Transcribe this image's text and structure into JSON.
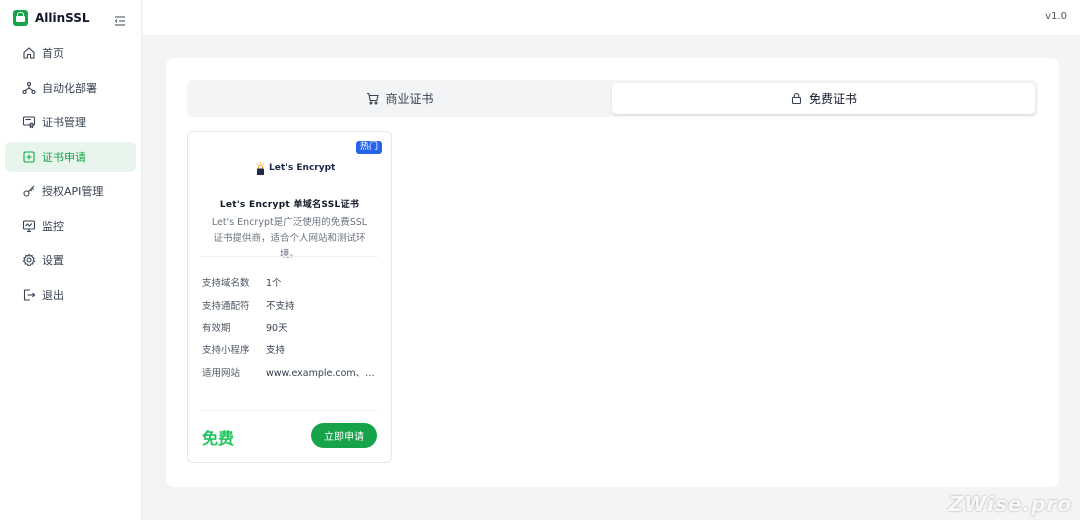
{
  "app": {
    "name": "AllinSSL",
    "version": "v1.0"
  },
  "sidebar": {
    "items": [
      {
        "label": "首页",
        "icon": "home-icon",
        "active": false
      },
      {
        "label": "自动化部署",
        "icon": "workflow-icon",
        "active": false
      },
      {
        "label": "证书管理",
        "icon": "certificate-icon",
        "active": false
      },
      {
        "label": "证书申请",
        "icon": "plus-square-icon",
        "active": true
      },
      {
        "label": "授权API管理",
        "icon": "key-icon",
        "active": false
      },
      {
        "label": "监控",
        "icon": "monitor-icon",
        "active": false
      },
      {
        "label": "设置",
        "icon": "gear-icon",
        "active": false
      },
      {
        "label": "退出",
        "icon": "logout-icon",
        "active": false
      }
    ]
  },
  "tabs": [
    {
      "label": "商业证书",
      "icon": "cart-icon",
      "selected": false
    },
    {
      "label": "免费证书",
      "icon": "lock-icon",
      "selected": true
    }
  ],
  "product": {
    "badge": "热门",
    "logo_text": "Let's Encrypt",
    "name": "Let's Encrypt 单域名SSL证书",
    "description": "Let's Encrypt是广泛使用的免费SSL证书提供商，适合个人网站和测试环境。",
    "specs": [
      {
        "label": "支持域名数",
        "value": "1个"
      },
      {
        "label": "支持通配符",
        "value": "不支持"
      },
      {
        "label": "有效期",
        "value": "90天"
      },
      {
        "label": "支持小程序",
        "value": "支持"
      },
      {
        "label": "适用网站",
        "value": "www.example.com、example.com"
      }
    ],
    "price": "免费",
    "apply_label": "立即申请"
  },
  "watermark": "ZWise.pro",
  "colors": {
    "accent": "#16a34a",
    "active_bg": "#e8f5ec",
    "badge": "#2563eb",
    "price": "#22c55e"
  }
}
